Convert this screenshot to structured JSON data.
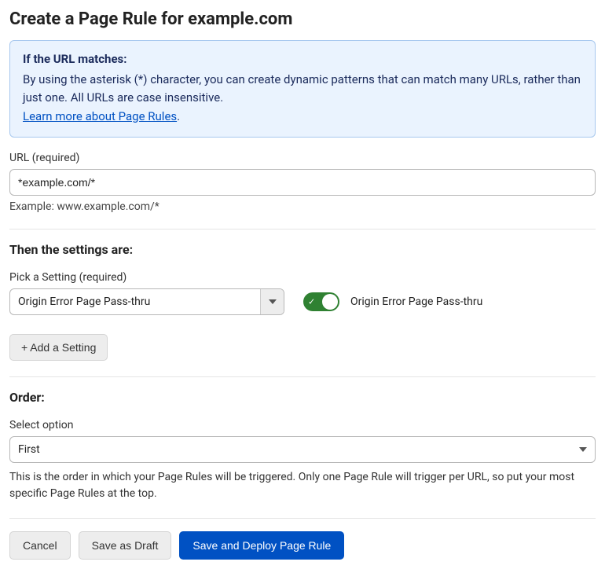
{
  "title": "Create a Page Rule for example.com",
  "info": {
    "heading": "If the URL matches:",
    "body": "By using the asterisk (*) character, you can create dynamic patterns that can match many URLs, rather than just one. All URLs are case insensitive.",
    "link_text": "Learn more about Page Rules",
    "link_suffix": "."
  },
  "url_field": {
    "label": "URL (required)",
    "value": "*example.com/*",
    "helper": "Example: www.example.com/*"
  },
  "settings_section": {
    "heading": "Then the settings are:",
    "picker_label": "Pick a Setting (required)",
    "selected_setting": "Origin Error Page Pass-thru",
    "toggle_label": "Origin Error Page Pass-thru",
    "toggle_on": true,
    "add_button": "+ Add a Setting"
  },
  "order_section": {
    "heading": "Order:",
    "label": "Select option",
    "selected": "First",
    "description": "This is the order in which your Page Rules will be triggered. Only one Page Rule will trigger per URL, so put your most specific Page Rules at the top."
  },
  "buttons": {
    "cancel": "Cancel",
    "draft": "Save as Draft",
    "deploy": "Save and Deploy Page Rule"
  }
}
